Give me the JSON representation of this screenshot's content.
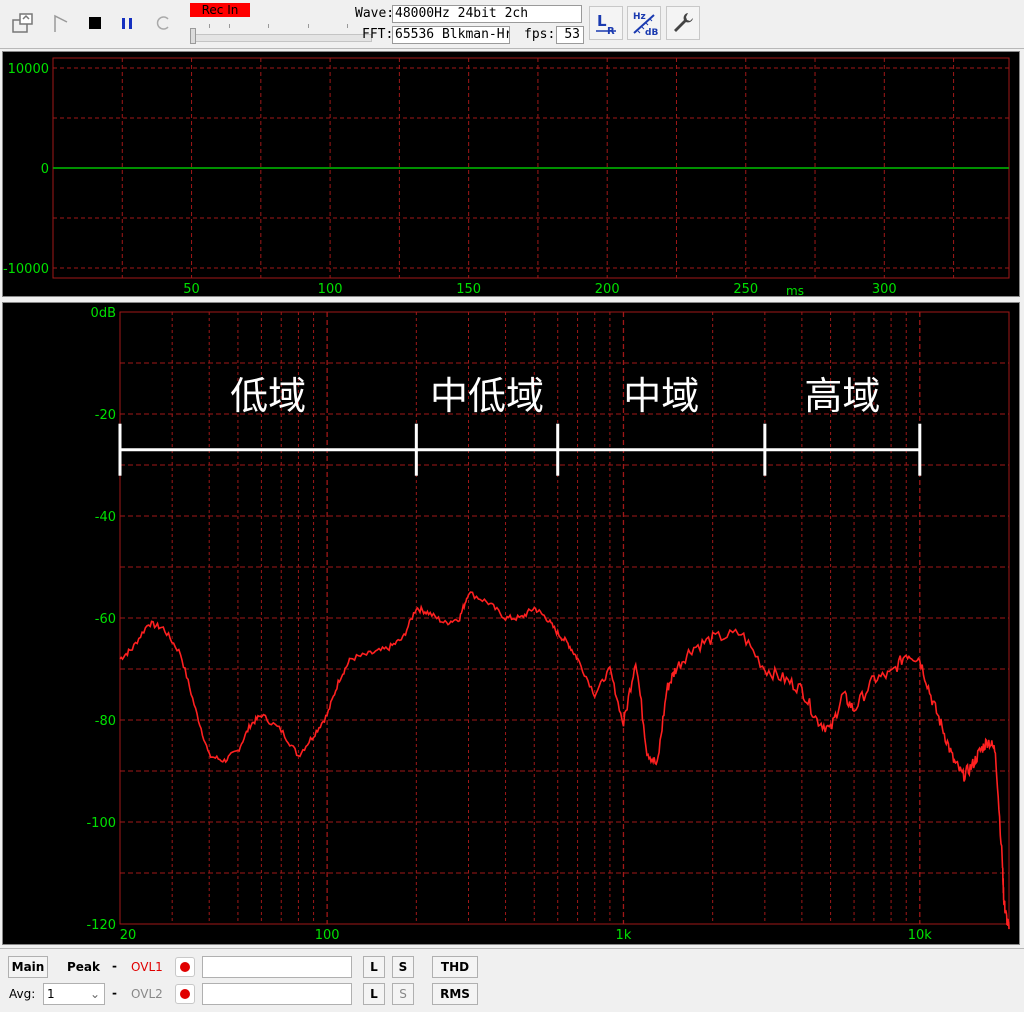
{
  "toolbar": {
    "rec_label": "Rec In",
    "wave_label": "Wave:",
    "wave_value": "48000Hz 24bit 2ch",
    "fft_label": "FFT:",
    "fft_value": "65536 Blkman-Hr",
    "fps_label": "fps:",
    "fps_value": "53",
    "lr_icon": "L/R channel icon",
    "hz_label": "Hz",
    "db_label": "dB",
    "icons": [
      "file-open-icon",
      "marker-icon",
      "stop-icon",
      "pause-icon",
      "reload-icon",
      "channel-lr-icon",
      "hz-db-scale-icon",
      "settings-wrench-icon"
    ]
  },
  "waveform": {
    "y_ticks": [
      "10000",
      "0",
      "-10000"
    ],
    "x_ticks": [
      "50",
      "100",
      "150",
      "200",
      "250",
      "300"
    ],
    "x_unit": "ms",
    "line_color": "#00c000",
    "grid_color": "#a01818"
  },
  "spectrum": {
    "y_ticks": [
      "0dB",
      "-20",
      "-40",
      "-60",
      "-80",
      "-100",
      "-120"
    ],
    "x_ticks": [
      "20",
      "100",
      "1k",
      "10k"
    ],
    "line_color": "#ff2020",
    "bands": [
      {
        "label": "低域"
      },
      {
        "label": "中低域"
      },
      {
        "label": "中域"
      },
      {
        "label": "高域"
      }
    ]
  },
  "chart_data": [
    {
      "type": "line",
      "xlabel": "ms",
      "ylabel": "",
      "xlim": [
        0,
        345
      ],
      "ylim": [
        -11000,
        11000
      ],
      "x_ticks": [
        50,
        100,
        150,
        200,
        250,
        300
      ],
      "y_ticks": [
        10000,
        0,
        -10000
      ],
      "series": [
        {
          "x": [
            0,
            345
          ],
          "y": [
            0,
            0
          ]
        }
      ],
      "grid": true
    },
    {
      "type": "line",
      "xscale": "log",
      "xlabel": "",
      "ylabel": "dB",
      "xlim": [
        20,
        20000
      ],
      "ylim": [
        -120,
        0
      ],
      "x_ticks": [
        20,
        100,
        1000,
        10000
      ],
      "y_ticks": [
        0,
        -20,
        -40,
        -60,
        -80,
        -100,
        -120
      ],
      "band_edges_hz": [
        20,
        200,
        600,
        3000,
        10000
      ],
      "series": [
        {
          "x": [
            20,
            22,
            25,
            28,
            32,
            36,
            40,
            45,
            50,
            55,
            60,
            70,
            80,
            90,
            100,
            110,
            120,
            140,
            160,
            180,
            200,
            220,
            250,
            280,
            300,
            350,
            400,
            450,
            500,
            550,
            600,
            650,
            700,
            800,
            900,
            1000,
            1100,
            1200,
            1300,
            1400,
            1500,
            1700,
            2000,
            2500,
            3000,
            3500,
            4000,
            4500,
            5000,
            5500,
            6000,
            7000,
            8000,
            9000,
            10000,
            11000,
            12000,
            13000,
            14000,
            15000,
            16000,
            17000,
            18000,
            19000,
            19200,
            19500,
            20000
          ],
          "y": [
            -68,
            -66,
            -61,
            -62,
            -67,
            -78,
            -87,
            -88,
            -86,
            -81,
            -79,
            -82,
            -87,
            -83,
            -79,
            -72,
            -68,
            -67,
            -66,
            -64,
            -58,
            -59,
            -61,
            -60,
            -55,
            -57,
            -60,
            -60,
            -58,
            -60,
            -63,
            -65,
            -68,
            -75,
            -70,
            -81,
            -68,
            -86,
            -89,
            -74,
            -70,
            -66,
            -64,
            -63,
            -70,
            -72,
            -74,
            -80,
            -82,
            -75,
            -78,
            -72,
            -71,
            -67,
            -68,
            -76,
            -82,
            -88,
            -91,
            -89,
            -86,
            -84,
            -86,
            -108,
            -115,
            -118,
            -121
          ]
        }
      ],
      "grid": true
    }
  ],
  "bottom": {
    "main_label": "Main",
    "peak_label": "Peak",
    "dash1": "-",
    "ovl1_label": "OVL1",
    "avg_label": "Avg:",
    "avg_value": "1",
    "dash2": "-",
    "ovl2_label": "OVL2",
    "l_label": "L",
    "s_label": "S",
    "thd_label": "THD",
    "rms_label": "RMS"
  }
}
